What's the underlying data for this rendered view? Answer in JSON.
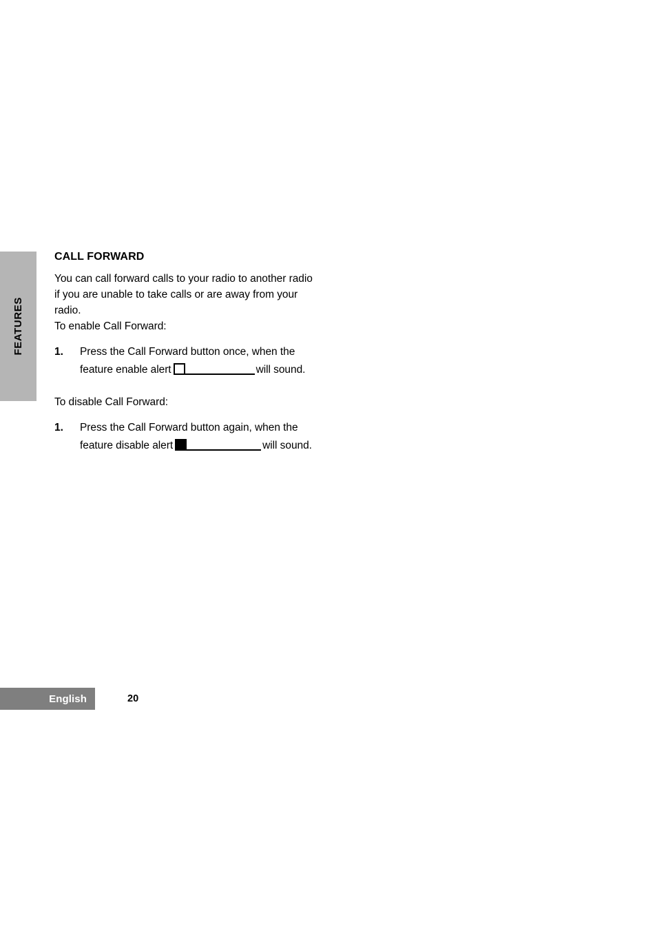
{
  "page": {
    "chapter_tab_label": "FEATURES",
    "background_color": "#ffffff",
    "tab_color": "#b5b5b5",
    "footer_band_color": "#7f7f7f"
  },
  "section": {
    "heading": "CALL FORWARD",
    "intro_paragraph": "You can call forward calls to your radio to another radio if you are unable to take calls or are away from your radio.",
    "enable_lead_in": "To enable Call Forward:",
    "disable_lead_in": "To disable Call Forward:"
  },
  "enable_step": {
    "number": "1.",
    "text_before_glyph": "Press the Call Forward button once, when the feature enable alert",
    "glyph_name": "feature-enable-alert-tone",
    "text_after_glyph": "will sound."
  },
  "disable_step": {
    "number": "1.",
    "text_before_glyph": "Press the Call Forward button again, when the feature disable alert",
    "glyph_name": "feature-disable-alert-tone",
    "text_after_glyph": "will sound."
  },
  "footer": {
    "language": "English",
    "page_number": "20"
  }
}
